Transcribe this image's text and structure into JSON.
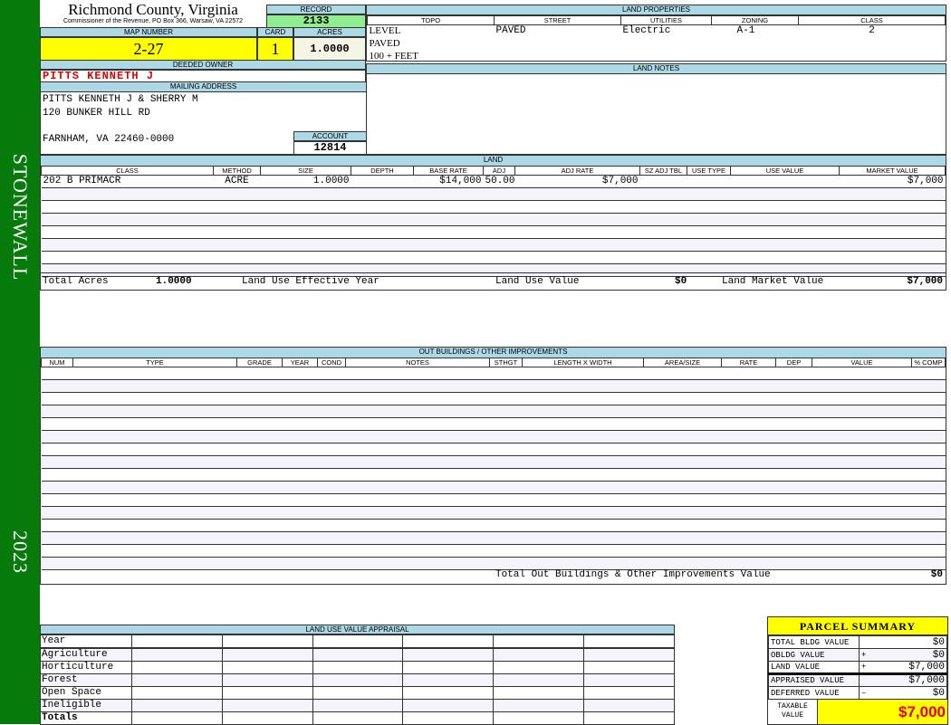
{
  "sidebar": {
    "district": "STONEWALL",
    "year": "2023",
    "color": "#067a0a"
  },
  "header": {
    "county": "Richmond County, Virginia",
    "address": "Commissioner of the Revenue, PO Box 366, Warsaw, VA 22572"
  },
  "record": {
    "label": "RECORD",
    "value": "2133"
  },
  "map": {
    "map_label": "MAP NUMBER",
    "map_value": "2-27",
    "card_label": "CARD",
    "card_value": "1",
    "acres_label": "ACRES",
    "acres_value": "1.0000"
  },
  "owner": {
    "label": "DEEDED OWNER",
    "value": "PITTS KENNETH J"
  },
  "mailing": {
    "label": "MAILING ADDRESS",
    "line1": "PITTS KENNETH J & SHERRY M",
    "line2": "120 BUNKER HILL RD",
    "line3": "FARNHAM, VA 22460-0000"
  },
  "account": {
    "label": "ACCOUNT",
    "value": "12814"
  },
  "land_properties": {
    "title": "LAND PROPERTIES",
    "headers": [
      "TOPO",
      "STREET",
      "UTILITIES",
      "ZONING",
      "CLASS"
    ],
    "topo": [
      "LEVEL",
      "PAVED",
      "100 + FEET"
    ],
    "street": "PAVED",
    "utilities": "Electric",
    "zoning": "A-1",
    "class": "2"
  },
  "land_notes": {
    "title": "LAND NOTES"
  },
  "land": {
    "title": "LAND",
    "headers": [
      "CLASS",
      "METHOD",
      "SIZE",
      "DEPTH",
      "BASE RATE",
      "ADJ",
      "ADJ RATE",
      "SZ ADJ TBL",
      "USE TYPE",
      "USE VALUE",
      "MARKET VALUE"
    ],
    "rows": [
      {
        "class": "202 B PRIMACR",
        "method": "ACRE",
        "size": "1.0000",
        "depth": "",
        "base_rate": "$14,000",
        "adj": "50.00",
        "adj_rate": "$7,000",
        "sz_adj_tbl": "",
        "use_type": "",
        "use_value": "",
        "market_value": "$7,000"
      }
    ],
    "totals": {
      "acres_label": "Total Acres",
      "acres": "1.0000",
      "eff_year_label": "Land Use Effective Year",
      "eff_year": "",
      "use_value_label": "Land Use Value",
      "use_value": "$0",
      "market_label": "Land Market Value",
      "market": "$7,000"
    }
  },
  "outbuildings": {
    "title": "OUT BUILDINGS / OTHER IMPROVEMENTS",
    "headers": [
      "NUM",
      "TYPE",
      "GRADE",
      "YEAR",
      "COND",
      "NOTES",
      "STHGT",
      "LENGTH X WIDTH",
      "AREA/SIZE",
      "RATE",
      "DEP",
      "VALUE",
      "% COMP"
    ],
    "total_label": "Total Out Buildings & Other Improvements Value",
    "total": "$0"
  },
  "land_use": {
    "title": "LAND USE VALUE APPRAISAL",
    "year_label": "Year",
    "rows": [
      "Agriculture",
      "Horticulture",
      "Forest",
      "Open Space",
      "Ineligible"
    ],
    "totals_label": "Totals"
  },
  "parcel_summary": {
    "title": "PARCEL SUMMARY",
    "rows": [
      {
        "label": "TOTAL BLDG VALUE",
        "op": "",
        "value": "$0"
      },
      {
        "label": "OBLDG VALUE",
        "op": "+",
        "value": "$0"
      },
      {
        "label": "LAND VALUE",
        "op": "+",
        "value": "$7,000"
      },
      {
        "label": "APPRAISED VALUE",
        "op": "",
        "value": "$7,000"
      },
      {
        "label": "DEFERRED VALUE",
        "op": "–",
        "value": "$0"
      }
    ],
    "taxable_label": "TAXABLE VALUE",
    "taxable": "$7,000"
  }
}
